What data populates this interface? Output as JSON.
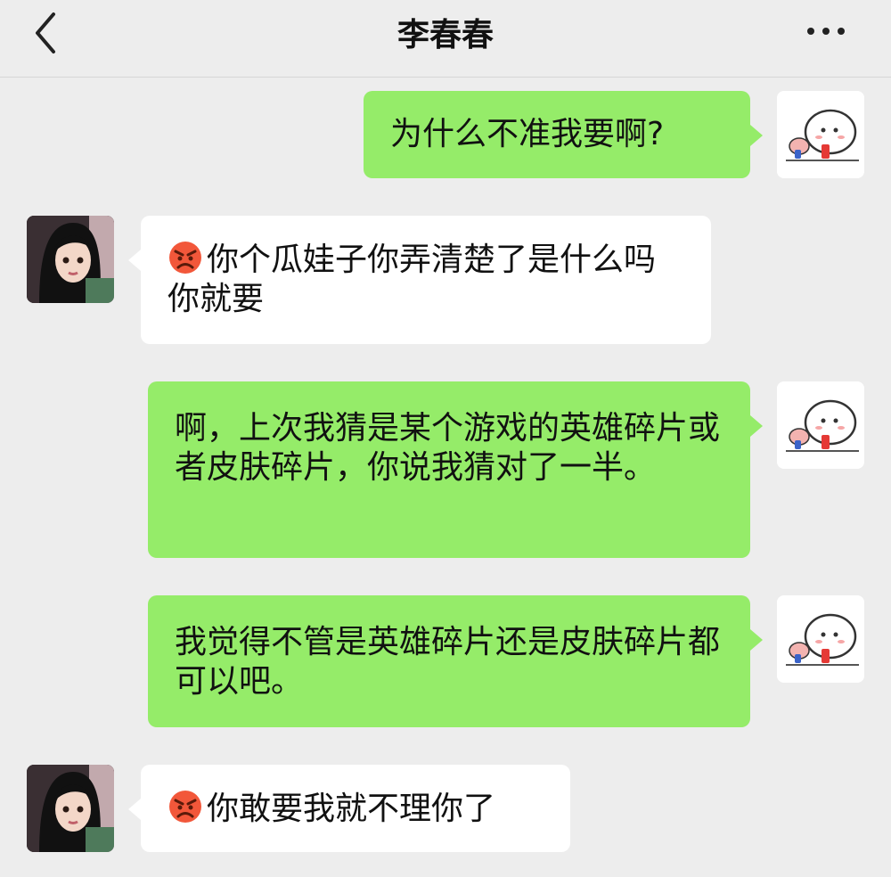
{
  "header": {
    "title": "李春春",
    "back_icon": "chevron-left-icon",
    "more_icon": "more-horizontal-icon"
  },
  "colors": {
    "self_bubble": "#95ec69",
    "other_bubble": "#ffffff",
    "background": "#ededed"
  },
  "messages": [
    {
      "sender": "self",
      "text": "为什么不准我要啊?"
    },
    {
      "sender": "other",
      "emoji": "angry-face-icon",
      "text": "你个瓜娃子你弄清楚了是什么吗你就要"
    },
    {
      "sender": "self",
      "text": "啊，上次我猜是某个游戏的英雄碎片或者皮肤碎片，你说我猜对了一半。"
    },
    {
      "sender": "self",
      "text": "我觉得不管是英雄碎片还是皮肤碎片都可以吧。"
    },
    {
      "sender": "other",
      "emoji": "angry-face-icon",
      "text": "你敢要我就不理你了"
    }
  ]
}
